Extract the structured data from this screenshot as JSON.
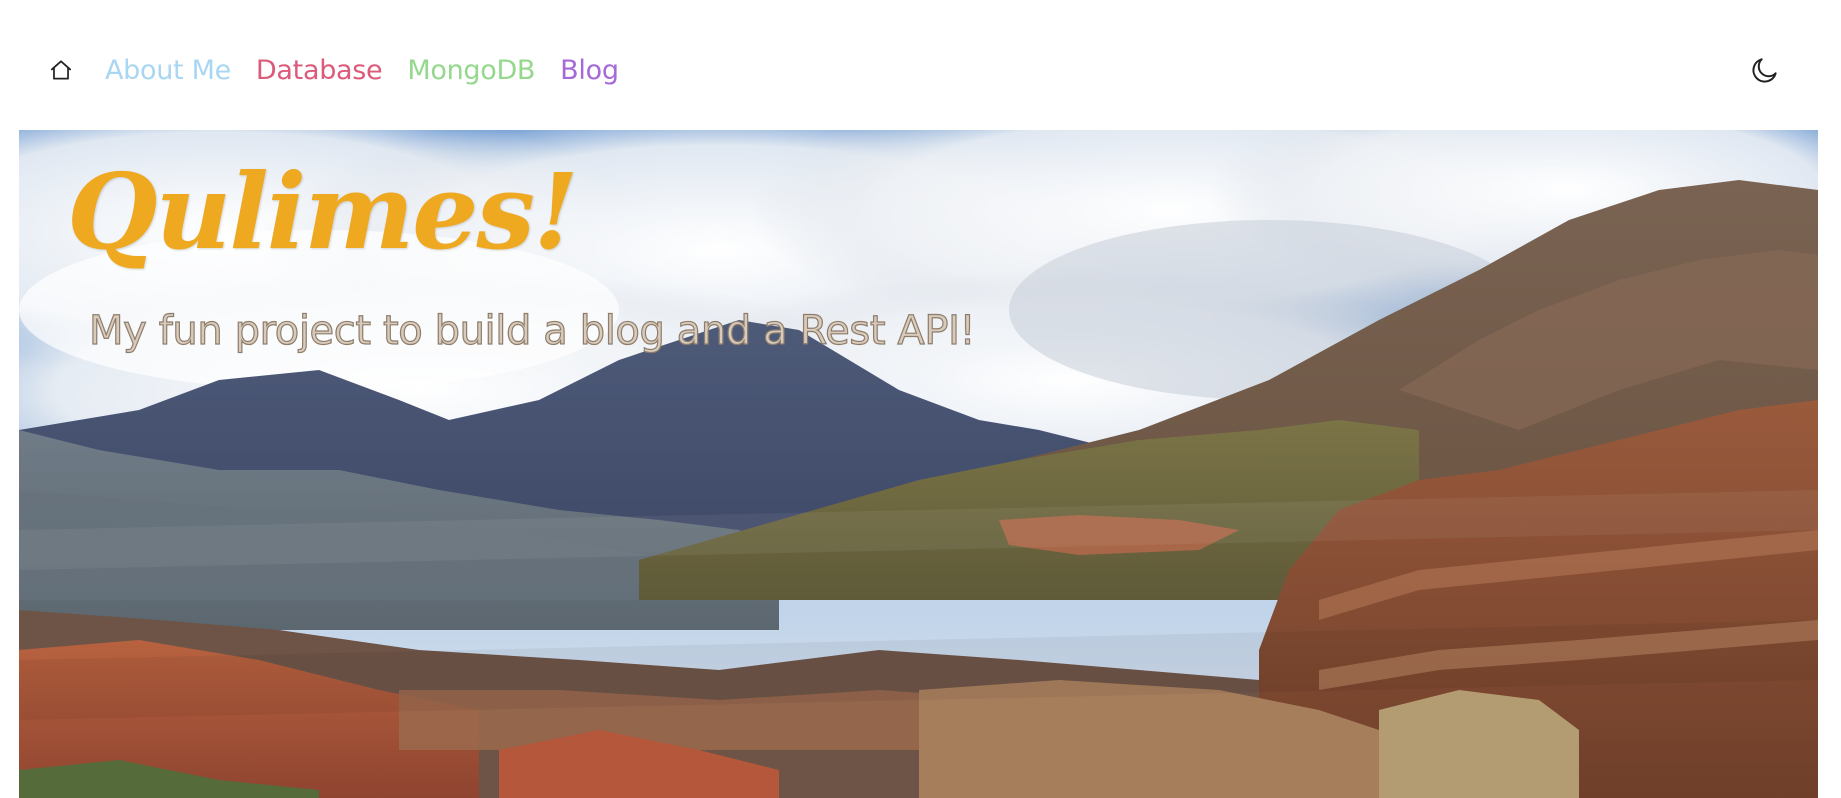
{
  "nav": {
    "home_icon": "home-icon",
    "links": [
      {
        "label": "About Me",
        "color": "#a9d6f3"
      },
      {
        "label": "Database",
        "color": "#dc5b7a"
      },
      {
        "label": "MongoDB",
        "color": "#95d88d"
      },
      {
        "label": "Blog",
        "color": "#a56ad8"
      }
    ],
    "theme_icon": "moon-icon"
  },
  "hero": {
    "title": "Qulimes!",
    "title_color": "#eea920",
    "subtitle": "My fun project to build a blog and a Rest API!",
    "subtitle_color": "#d9cbbb",
    "image_description_icon": "mountain-landscape-photo"
  }
}
